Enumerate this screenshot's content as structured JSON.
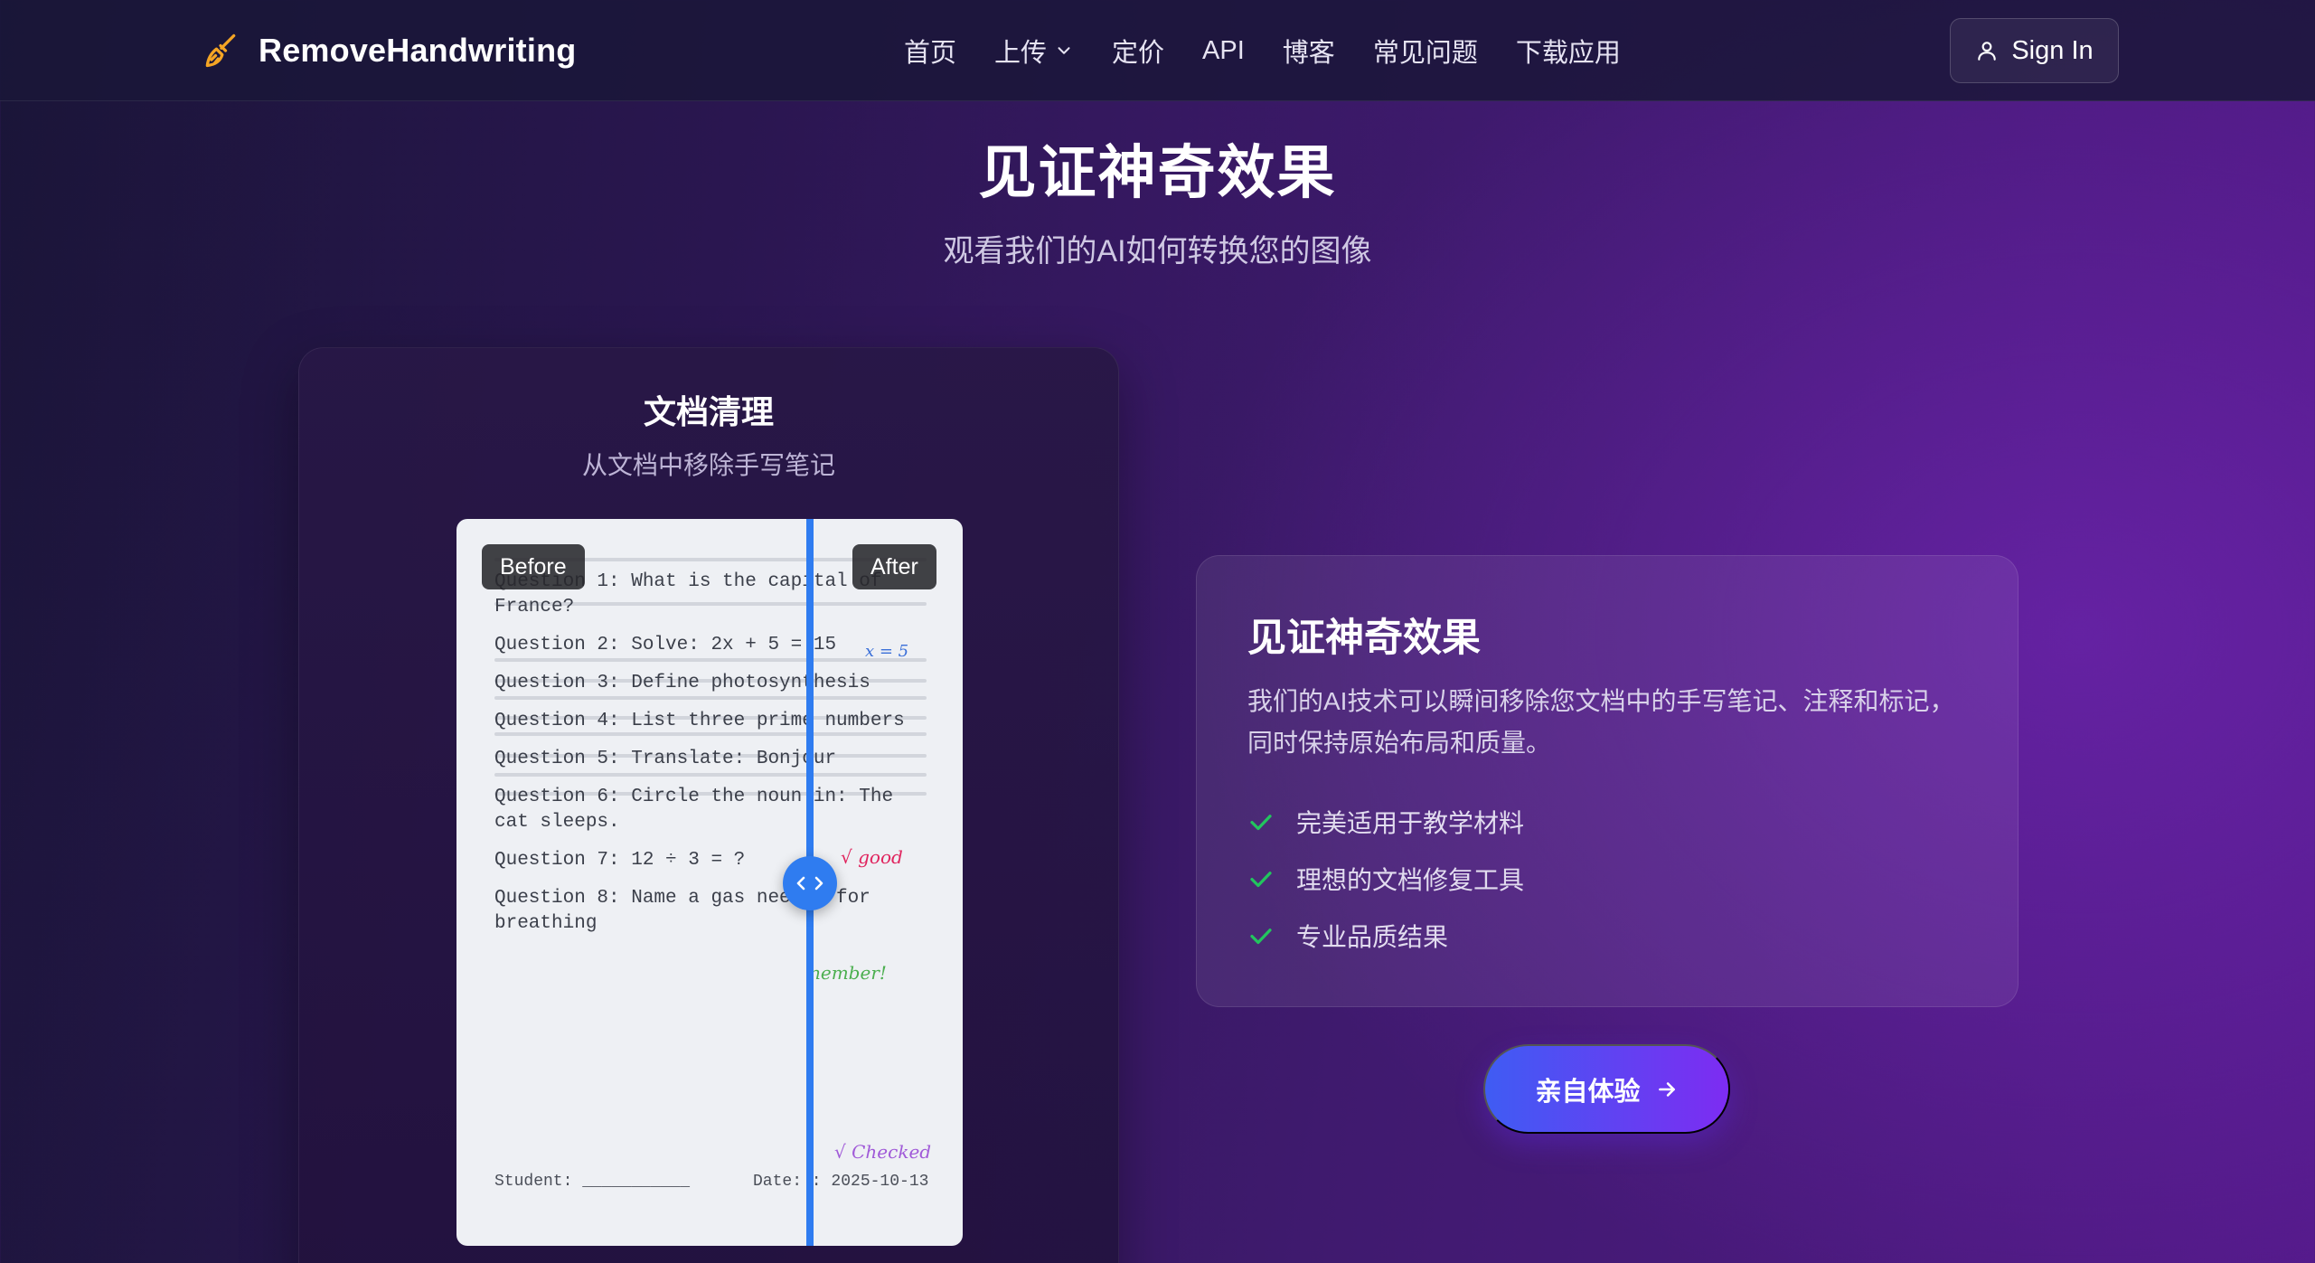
{
  "nav": {
    "brand": "RemoveHandwriting",
    "items": [
      {
        "label": "首页"
      },
      {
        "label": "上传",
        "has_dropdown": true
      },
      {
        "label": "定价"
      },
      {
        "label": "API"
      },
      {
        "label": "博客"
      },
      {
        "label": "常见问题"
      },
      {
        "label": "下载应用"
      }
    ],
    "signin_label": "Sign In"
  },
  "hero": {
    "title": "见证神奇效果",
    "subtitle": "观看我们的AI如何转换您的图像"
  },
  "demo_card": {
    "title": "文档清理",
    "subtitle": "从文档中移除手写笔记",
    "before_label": "Before",
    "after_label": "After",
    "slider_position": 0.7,
    "document": {
      "questions": [
        "Question 1: What is the capital of France?",
        "Question 2: Solve: 2x + 5 = 15",
        "Question 3: Define photosynthesis",
        "Question 4: List three prime numbers",
        "Question 5: Translate: Bonjour",
        "Question 6: Circle the noun in: The cat sleeps.",
        "Question 7: 12 ÷ 3 = ?",
        "Question 8: Name a gas needed for breathing"
      ],
      "annotations": {
        "equation": "x = 5",
        "good": "√ good",
        "remember": "nember!",
        "checked": "√ Checked"
      },
      "student_label": "Student: ___________",
      "date_label": "Date: : 2025-10-13"
    }
  },
  "info_card": {
    "title": "见证神奇效果",
    "description": "我们的AI技术可以瞬间移除您文档中的手写笔记、注释和标记，同时保持原始布局和质量。",
    "features": [
      "完美适用于教学材料",
      "理想的文档修复工具",
      "专业品质结果"
    ]
  },
  "cta": {
    "label": "亲自体验"
  },
  "colors": {
    "accent_blue": "#2f7cf0",
    "check_green": "#22c55e",
    "cta_start": "#3f5cf3",
    "cta_end": "#7d2cf2",
    "annotation_blue": "#3a6fd8",
    "annotation_red": "#e0245e",
    "annotation_green": "#4caf50",
    "annotation_purple": "#a05ad8"
  },
  "icons": {
    "brand": "broom-icon",
    "dropdown": "chevron-down-icon",
    "signin": "user-icon",
    "feature": "check-icon",
    "cta": "arrow-right-icon",
    "handle": "chevron-left-right-icon"
  }
}
